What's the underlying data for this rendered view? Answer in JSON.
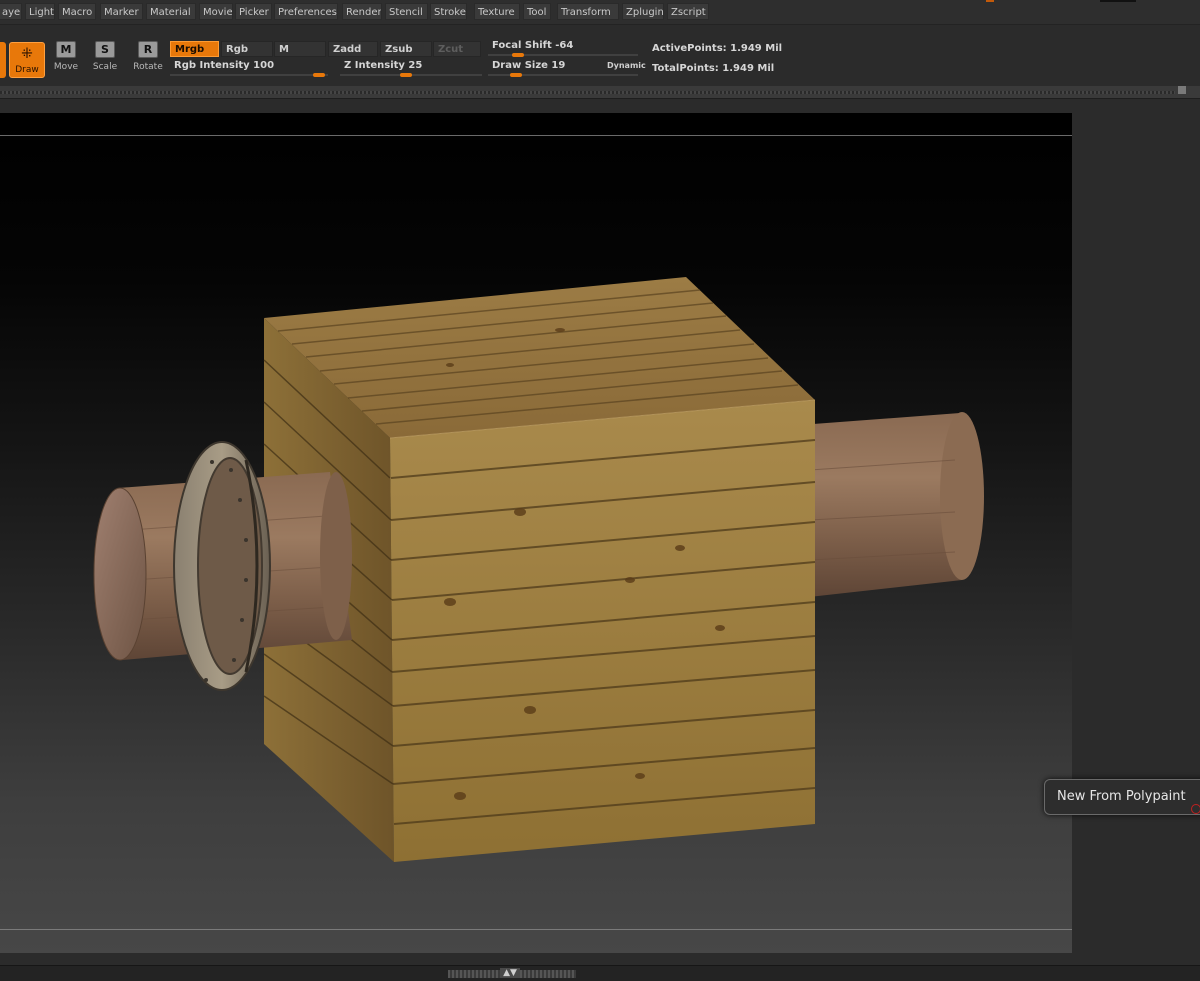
{
  "menu": {
    "items": [
      "ayer",
      "Light",
      "Macro",
      "Marker",
      "Material",
      "Movie",
      "Picker",
      "Preferences",
      "Render",
      "Stencil",
      "Stroke",
      "Texture",
      "Tool",
      "Transform",
      "Zplugin",
      "Zscript"
    ]
  },
  "tools": {
    "draw": {
      "label": "Draw",
      "icon": "draw-crosshair-icon"
    },
    "move": {
      "label": "Move",
      "glyph": "M",
      "icon": "move-icon"
    },
    "scale": {
      "label": "Scale",
      "glyph": "S",
      "icon": "scale-icon"
    },
    "rotate": {
      "label": "Rotate",
      "glyph": "R",
      "icon": "rotate-icon"
    }
  },
  "modes": {
    "mrgb": "Mrgb",
    "rgb": "Rgb",
    "m": "M",
    "zadd": "Zadd",
    "zsub": "Zsub",
    "zcut": "Zcut",
    "selected": "Mrgb"
  },
  "sliders": {
    "rgb_intensity": {
      "label": "Rgb  Intensity 100",
      "value": 100,
      "max": 100
    },
    "z_intensity": {
      "label": "Z  Intensity 25",
      "value": 25,
      "max": 100
    },
    "focal_shift": {
      "label": "Focal  Shift -64",
      "value": -64,
      "min": -100,
      "max": 100
    },
    "draw_size": {
      "label": "Draw  Size 19",
      "value": 19,
      "max": 1000
    }
  },
  "dynamic_label": "Dynamic",
  "stats": {
    "active_points": "ActivePoints: 1.949  Mil",
    "total_points": "TotalPoints: 1.949  Mil"
  },
  "tooltip": {
    "text": "New From Polypaint"
  },
  "colors": {
    "accent": "#e8780a",
    "ui_bg": "#2b2b2b"
  }
}
